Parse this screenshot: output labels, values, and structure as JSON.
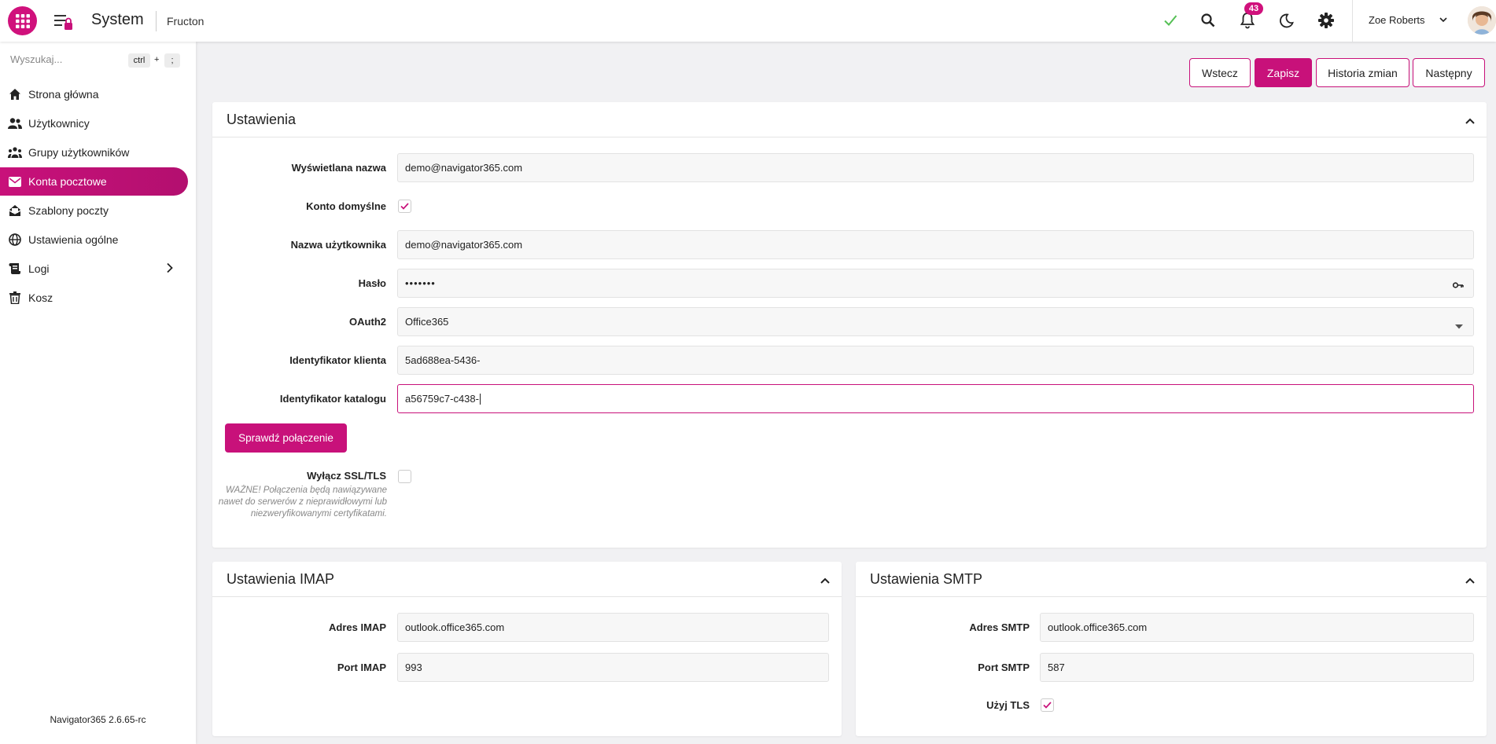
{
  "header": {
    "title": "System",
    "company": "Fructon",
    "notifications_count": "43",
    "user_name": "Zoe Roberts"
  },
  "colors": {
    "accent": "#c8117a",
    "success": "#55c055"
  },
  "icons": [
    "apps-grid-icon",
    "menu-lock-icon",
    "check-icon",
    "search-icon",
    "bell-icon",
    "moon-icon",
    "gear-icon",
    "chevron-down-icon",
    "avatar"
  ],
  "sidebar": {
    "search_placeholder": "Wyszukaj...",
    "shortcut": {
      "key1": "ctrl",
      "plus": "+",
      "key2": ";"
    },
    "items": [
      {
        "label": "Strona główna",
        "icon": "home-icon"
      },
      {
        "label": "Użytkownicy",
        "icon": "users-icon"
      },
      {
        "label": "Grupy użytkowników",
        "icon": "user-groups-icon"
      },
      {
        "label": "Konta pocztowe",
        "icon": "envelope-icon",
        "active": true
      },
      {
        "label": "Szablony poczty",
        "icon": "mail-template-icon"
      },
      {
        "label": "Ustawienia ogólne",
        "icon": "globe-icon"
      },
      {
        "label": "Logi",
        "icon": "scroll-icon"
      },
      {
        "label": "Kosz",
        "icon": "trash-icon"
      }
    ],
    "version": "Navigator365 2.6.65-rc"
  },
  "toolbar": {
    "back": "Wstecz",
    "save": "Zapisz",
    "history": "Historia zmian",
    "next": "Następny"
  },
  "settings": {
    "title": "Ustawienia",
    "display_name_label": "Wyświetlana nazwa",
    "display_name_value": "demo@navigator365.com",
    "default_account_label": "Konto domyślne",
    "default_account_checked": true,
    "username_label": "Nazwa użytkownika",
    "username_value": "demo@navigator365.com",
    "password_label": "Hasło",
    "password_value": "•••••••",
    "oauth_label": "OAuth2",
    "oauth_value": "Office365",
    "client_id_label": "Identyfikator klienta",
    "client_id_value": "5ad688ea-5436-",
    "tenant_id_label": "Identyfikator katalogu",
    "tenant_id_value": "a56759c7-c438-",
    "test_connection": "Sprawdź połączenie",
    "disable_ssl_label": "Wyłącz SSL/TLS",
    "disable_ssl_checked": false,
    "disable_ssl_note": "WAŻNE! Połączenia będą nawiązywane nawet do serwerów z nieprawidłowymi lub niezweryfikowanymi certyfikatami."
  },
  "imap": {
    "title": "Ustawienia IMAP",
    "address_label": "Adres IMAP",
    "address_value": "outlook.office365.com",
    "port_label": "Port IMAP",
    "port_value": "993"
  },
  "smtp": {
    "title": "Ustawienia SMTP",
    "address_label": "Adres SMTP",
    "address_value": "outlook.office365.com",
    "port_label": "Port SMTP",
    "port_value": "587",
    "tls_label": "Użyj TLS",
    "tls_checked": true
  }
}
